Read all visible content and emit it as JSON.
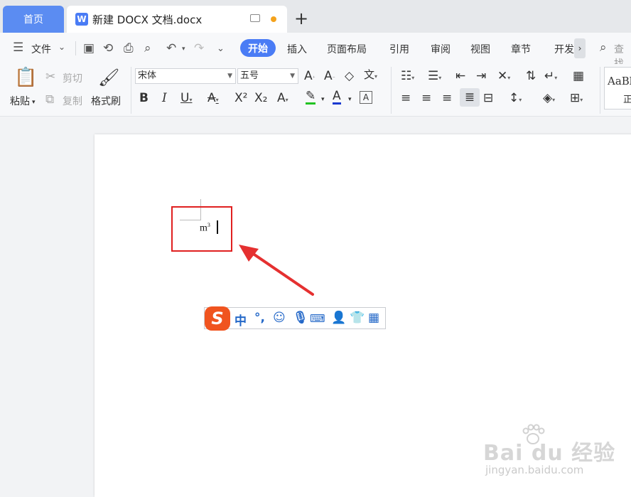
{
  "tabs": {
    "home": "首页",
    "doc_title": "新建 DOCX 文档.docx",
    "doc_icon_letter": "W"
  },
  "menu": {
    "file": "文件",
    "start": "开始",
    "items": [
      "插入",
      "页面布局",
      "引用",
      "审阅",
      "视图",
      "章节",
      "开发"
    ],
    "search": "查找"
  },
  "ribbon": {
    "paste": "粘贴",
    "cut": "剪切",
    "copy": "复制",
    "format_painter": "格式刷",
    "font_name": "宋体",
    "font_size": "五号",
    "style_preview": "AaBl",
    "style_preview_sub": "正"
  },
  "document": {
    "typed_base": "m",
    "typed_sup": "3"
  },
  "ime": {
    "logo": "S",
    "mode": "中",
    "punct": "°,"
  },
  "watermark": {
    "brand": "Bai du 经验",
    "url": "jingyan.baidu.com"
  },
  "colors": {
    "accent": "#4a7cf5",
    "highlight_box": "#e02020",
    "ime_logo": "#f0541f"
  }
}
